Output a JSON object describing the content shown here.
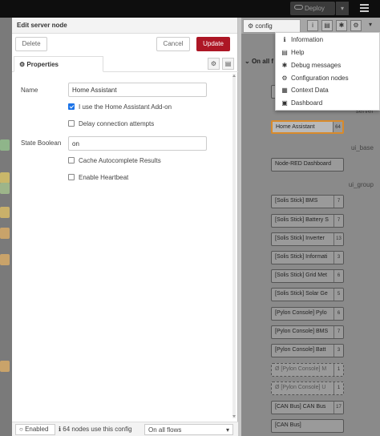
{
  "header": {
    "deploy_label": "Deploy",
    "deploy_dropdown": "▾"
  },
  "tray": {
    "title": "Edit server node",
    "delete_label": "Delete",
    "cancel_label": "Cancel",
    "update_label": "Update",
    "tab_properties": "Properties",
    "fields": {
      "name_label": "Name",
      "name_value": "Home Assistant",
      "addon_label": "I use the Home Assistant Add-on",
      "addon_checked": true,
      "delay_label": "Delay connection attempts",
      "delay_checked": false,
      "state_boolean_label": "State Boolean",
      "state_boolean_value": "on",
      "cache_label": "Cache Autocomplete Results",
      "cache_checked": false,
      "heartbeat_label": "Enable Heartbeat",
      "heartbeat_checked": false
    },
    "footer": {
      "enabled_label": "Enabled",
      "nodes_info": "64 nodes use this config",
      "flows_select": "On all flows"
    }
  },
  "sidebar": {
    "tab_label": "config",
    "section_label": "On all f",
    "groups": {
      "server_group": "server",
      "ui_base": "ui_base",
      "ui_group": "ui_group"
    },
    "config_nodes": [
      {
        "label": "Home Assistant",
        "count": "64"
      },
      {
        "label": "Node-RED Dashboard",
        "count": ""
      },
      {
        "label": "[Solis Stick] BMS",
        "count": "7"
      },
      {
        "label": "[Solis Stick] Battery S",
        "count": "7"
      },
      {
        "label": "[Solis Stick] Inverter",
        "count": "13"
      },
      {
        "label": "[Solis Stick] Informati",
        "count": "3"
      },
      {
        "label": "[Solis Stick] Grid Met",
        "count": "6"
      },
      {
        "label": "[Solis Stick] Solar Ge",
        "count": "5"
      },
      {
        "label": "[Pylon Console] Pylo",
        "count": "6"
      },
      {
        "label": "[Pylon Console] BMS",
        "count": "7"
      },
      {
        "label": "[Pylon Console] Batt",
        "count": "3"
      },
      {
        "label": "Ø [Pylon Console] M",
        "count": "1"
      },
      {
        "label": "Ø [Pylon Console] U",
        "count": "1"
      },
      {
        "label": "[CAN Bus] CAN Bus",
        "count": "17"
      },
      {
        "label": "[CAN Bus]",
        "count": ""
      }
    ]
  },
  "menu": {
    "items": [
      {
        "label": "Information",
        "icon": "info-icon",
        "glyph": "ℹ"
      },
      {
        "label": "Help",
        "icon": "book-icon",
        "glyph": "▤"
      },
      {
        "label": "Debug messages",
        "icon": "bug-icon",
        "glyph": "✱"
      },
      {
        "label": "Configuration nodes",
        "icon": "gear-icon",
        "glyph": "⚙"
      },
      {
        "label": "Context Data",
        "icon": "database-icon",
        "glyph": "▦"
      },
      {
        "label": "Dashboard",
        "icon": "dashboard-icon",
        "glyph": "▣"
      }
    ]
  },
  "colors": {
    "update_button": "#ad1625",
    "selected_node_border": "#d88a2b",
    "checkbox_checked": "#1b73e8"
  }
}
